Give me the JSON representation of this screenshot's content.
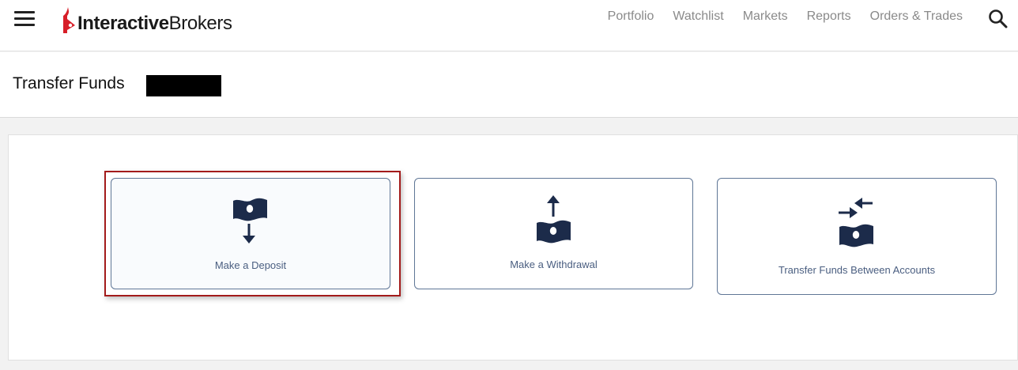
{
  "brand": {
    "name_bold": "Interactive",
    "name_light": "Brokers",
    "accent": "#d71e28"
  },
  "nav": {
    "items": [
      {
        "label": "Portfolio"
      },
      {
        "label": "Watchlist"
      },
      {
        "label": "Markets"
      },
      {
        "label": "Reports"
      },
      {
        "label": "Orders & Trades"
      }
    ],
    "icons": {
      "menu": "hamburger-menu-icon",
      "search": "search-icon"
    }
  },
  "page": {
    "title": "Transfer Funds"
  },
  "options": [
    {
      "label": "Make a Deposit",
      "icon": "money-deposit-icon",
      "selected": true
    },
    {
      "label": "Make a Withdrawal",
      "icon": "money-withdrawal-icon",
      "selected": false
    },
    {
      "label": "Transfer Funds Between Accounts",
      "icon": "money-transfer-icon",
      "selected": false
    }
  ],
  "colors": {
    "icon": "#1c2b4a",
    "card_border": "#5f7696",
    "label": "#4a5e80",
    "highlight": "#a31b1b"
  }
}
